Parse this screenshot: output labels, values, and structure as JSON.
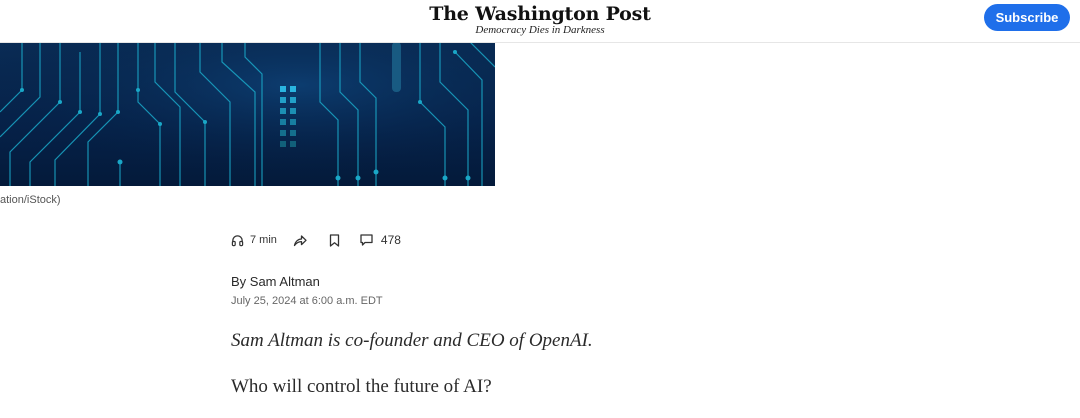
{
  "header": {
    "logo": "The Washington Post",
    "tagline": "Democracy Dies in Darkness",
    "subscribe_label": "Subscribe"
  },
  "hero": {
    "caption": "ation/iStock)",
    "colors": {
      "background": "#06224a",
      "trace": "#1aa7c7",
      "chip": "#23a6d5"
    }
  },
  "toolbar": {
    "listen_icon": "headphones-icon",
    "listen_time": "7 min",
    "share_icon": "share-icon",
    "save_icon": "bookmark-icon",
    "comments_icon": "comment-icon",
    "comments_count": "478"
  },
  "article": {
    "byline": "By Sam Altman",
    "dateline": "July 25, 2024 at 6:00 a.m. EDT",
    "intro": "Sam Altman is co-founder and CEO of OpenAI.",
    "first_paragraph": "Who will control the future of AI?"
  },
  "colors": {
    "subscribe": "#1f6fea",
    "text": "#2a2a2a",
    "muted": "#666666"
  }
}
